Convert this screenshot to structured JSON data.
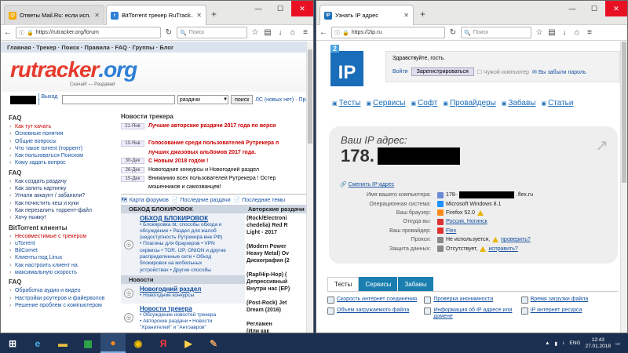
{
  "window1": {
    "tabs": [
      {
        "title": "Ответы Mail.Ru: если исп..."
      },
      {
        "title": "BitTorrent трекер RuTrack..."
      }
    ],
    "url": "https://rutracker.org/forum",
    "search_placeholder": "Поиск",
    "menu": "Главная · Трекер · Поиск · Правила · FAQ · Группы · Блог",
    "logo_main": "rutracker",
    "logo_tld": ".org",
    "logo_sub": "Скачай! — Раздавай",
    "search": {
      "exit": "[ Выход ]",
      "select": "раздачи",
      "button": "поиск",
      "pm": "ЛС (новых нет) · Проф"
    },
    "faq": {
      "title": "FAQ",
      "items": [
        "Как тут качать",
        "Основные понятия",
        "Общие вопросы",
        "Что такое torrent (торрент)",
        "Как пользоваться Поиском",
        "Кому задать вопрос"
      ]
    },
    "faq2": {
      "title": "FAQ",
      "items": [
        "Как создать раздачу",
        "Как залить картинку",
        "Угнали аккаунт / забанили?",
        "Как почистить кеш и куки",
        "Как перезалить торрент-файл",
        "Хочу пыжку!"
      ]
    },
    "bt": {
      "title": "BitTorrent клиенты",
      "items": [
        "Несовместимые с трекером",
        "uTorrent",
        "BitComet",
        "Клиенты под Linux",
        "Как настроить клиент на",
        "максимальную скорость"
      ]
    },
    "faq3": {
      "title": "FAQ",
      "items": [
        "Обработка аудио и видео",
        "Настройки роутеров и файерволов",
        "Решение проблем с компьютером"
      ]
    },
    "news": {
      "title": "Новости трекера",
      "rows": [
        {
          "date": "21-Янв",
          "text": "Лучшие авторские раздачи 2017 года по верси",
          "red": true
        },
        {
          "date": "",
          "text": "",
          "red": false
        },
        {
          "date": "10-Янв",
          "text": "Голосование среди пользователей Рутрекера п",
          "red": true
        },
        {
          "date": "",
          "text": "лучших джазовых альбомов 2017 года.",
          "red": true
        },
        {
          "date": "30-Дек",
          "text": "С Новым 2018 годом !",
          "red": true
        },
        {
          "date": "26-Дек",
          "text": "Новогодние конкурсы и Новогодний раздел",
          "red": false
        },
        {
          "date": "15-Дек",
          "text": "Вниманию всех пользователей Рутрекера ! Остер",
          "red": false
        },
        {
          "date": "",
          "text": "мошенников и самозванцев!",
          "red": false
        }
      ]
    },
    "forum_links": {
      "map": "Карта форумов",
      "last": "Последние раздачи",
      "topics": "Последние темы"
    },
    "panel": {
      "head1": "ОБХОД БЛОКИРОВОК",
      "head2": "Авторские раздачи",
      "t1": "ОБХОД БЛОКИРОВОК",
      "l1": [
        "• Блокировка bt, способы обхода и",
        "обсуждение • Раздел для жалоб",
        "(недоступность Рутрекера вне РФ)",
        "• Плагины для браузеров • VPN",
        "сервисы • TOR, I2P, ONION и другие",
        "распределенные сети • Обход",
        "блокировок на мобильных",
        "устройствах • Другие способы"
      ],
      "col2": [
        "(Rock/Electroni",
        "chedelia) Red R",
        "Light - 2017",
        "",
        "(Modern Power",
        "Heavy Metal) Ov",
        "Дискография (2",
        "",
        "(Rap/Hip-Hop) (",
        "Депрессивный",
        "Внутри нас (EP)",
        "",
        "(Post-Rock) Jet",
        "Dream (2016)",
        "",
        "Регламен",
        "(Или как"
      ],
      "news_head": "Новости",
      "t2": "Новогодний раздел",
      "l2": [
        "• Новогодние конкурсы"
      ],
      "t3": "Новости трекера",
      "l3": [
        "• Обсуждение новостей трекера",
        "• Авторские раздачи • Новости",
        "\"Хранителей\" и \"Антоавров\""
      ]
    }
  },
  "window2": {
    "tabs": [
      {
        "title": "Узнать IP адрес"
      }
    ],
    "url": "https://2ip.ru",
    "search_placeholder": "Поиск",
    "logo_num": "2",
    "logo_text": "IP",
    "greeting": "Здравствуйте, гость.",
    "login": "Войти",
    "register": "Зарегистрироваться",
    "checkbox": "Чужой компьютер",
    "forgot": "Вы забыли пароль",
    "nav": [
      "Тесты",
      "Сервисы",
      "Софт",
      "Провайдеры",
      "Забавы",
      "Статьи"
    ],
    "ip_label": "Ваш IP адрес:",
    "ip_prefix": "178.",
    "change": "Сменить IP-адрес",
    "info": [
      {
        "k": "Имя вашего компьютера:",
        "v": "178-",
        "v2": ".flex.ru",
        "link": false,
        "redact": true,
        "warn": false
      },
      {
        "k": "Операционная система:",
        "v": "Microsoft Windows 8.1",
        "v2": "",
        "link": false,
        "redact": false,
        "warn": false
      },
      {
        "k": "Ваш браузер:",
        "v": "Firefox 52.0",
        "v2": "",
        "link": false,
        "redact": false,
        "warn": true
      },
      {
        "k": "Откуда вы:",
        "v": "Россия, Ногинск",
        "v2": "",
        "link": true,
        "redact": false,
        "warn": false
      },
      {
        "k": "Ваш провайдер:",
        "v": "Flex",
        "v2": "",
        "link": true,
        "redact": false,
        "warn": false
      },
      {
        "k": "Прокси:",
        "v": "Не используется,",
        "v2": "проверить?",
        "link": false,
        "redact": false,
        "warn": true
      },
      {
        "k": "Защита данных:",
        "v": "Отсутствует,",
        "v2": "исправить?",
        "link": false,
        "redact": false,
        "warn": true
      }
    ],
    "bottom_tabs": [
      "Тесты",
      "Сервисы",
      "Забавы"
    ],
    "links": [
      "Скорость интернет соединения",
      "Проверка анонимности",
      "Время загрузки файла",
      "Объем загружаемого файла",
      "Информация об IP адресе или домене",
      "IP интернет ресурса"
    ]
  },
  "taskbar": {
    "lang": "ENG",
    "time": "12:43",
    "date": "27.01.2018"
  }
}
